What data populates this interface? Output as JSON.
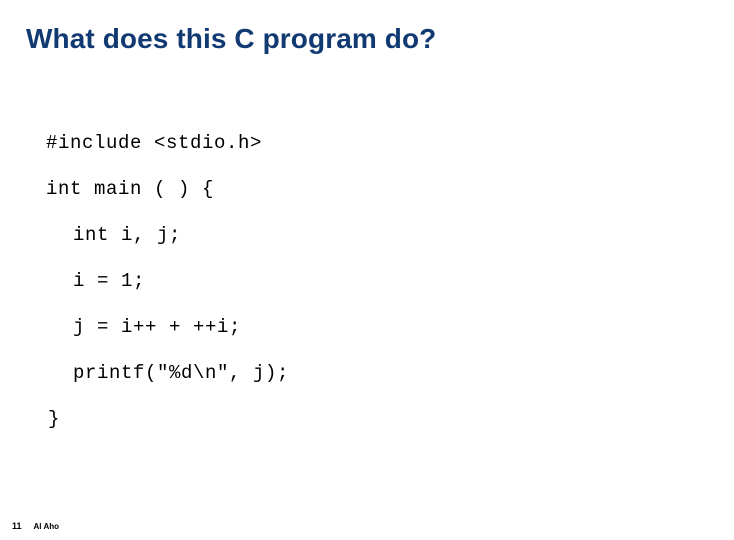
{
  "slide": {
    "title": "What does this C program do?",
    "title_color": "#113a72",
    "background_color": "#ffffff",
    "code_color": "#000000"
  },
  "code": {
    "language": "c",
    "lines": [
      {
        "text": "#include <stdio.h>",
        "indent": 0
      },
      {
        "text": "int main ( ) {",
        "indent": 0
      },
      {
        "text": "int i, j;",
        "indent": 1
      },
      {
        "text": "i = 1;",
        "indent": 1
      },
      {
        "text": "j = i++ + ++i;",
        "indent": 1
      },
      {
        "text": "printf(\"%d\\n\", j);",
        "indent": 1
      },
      {
        "text": "}",
        "indent": 0
      }
    ]
  },
  "footer": {
    "slide_number": "11",
    "author": "Al Aho"
  }
}
